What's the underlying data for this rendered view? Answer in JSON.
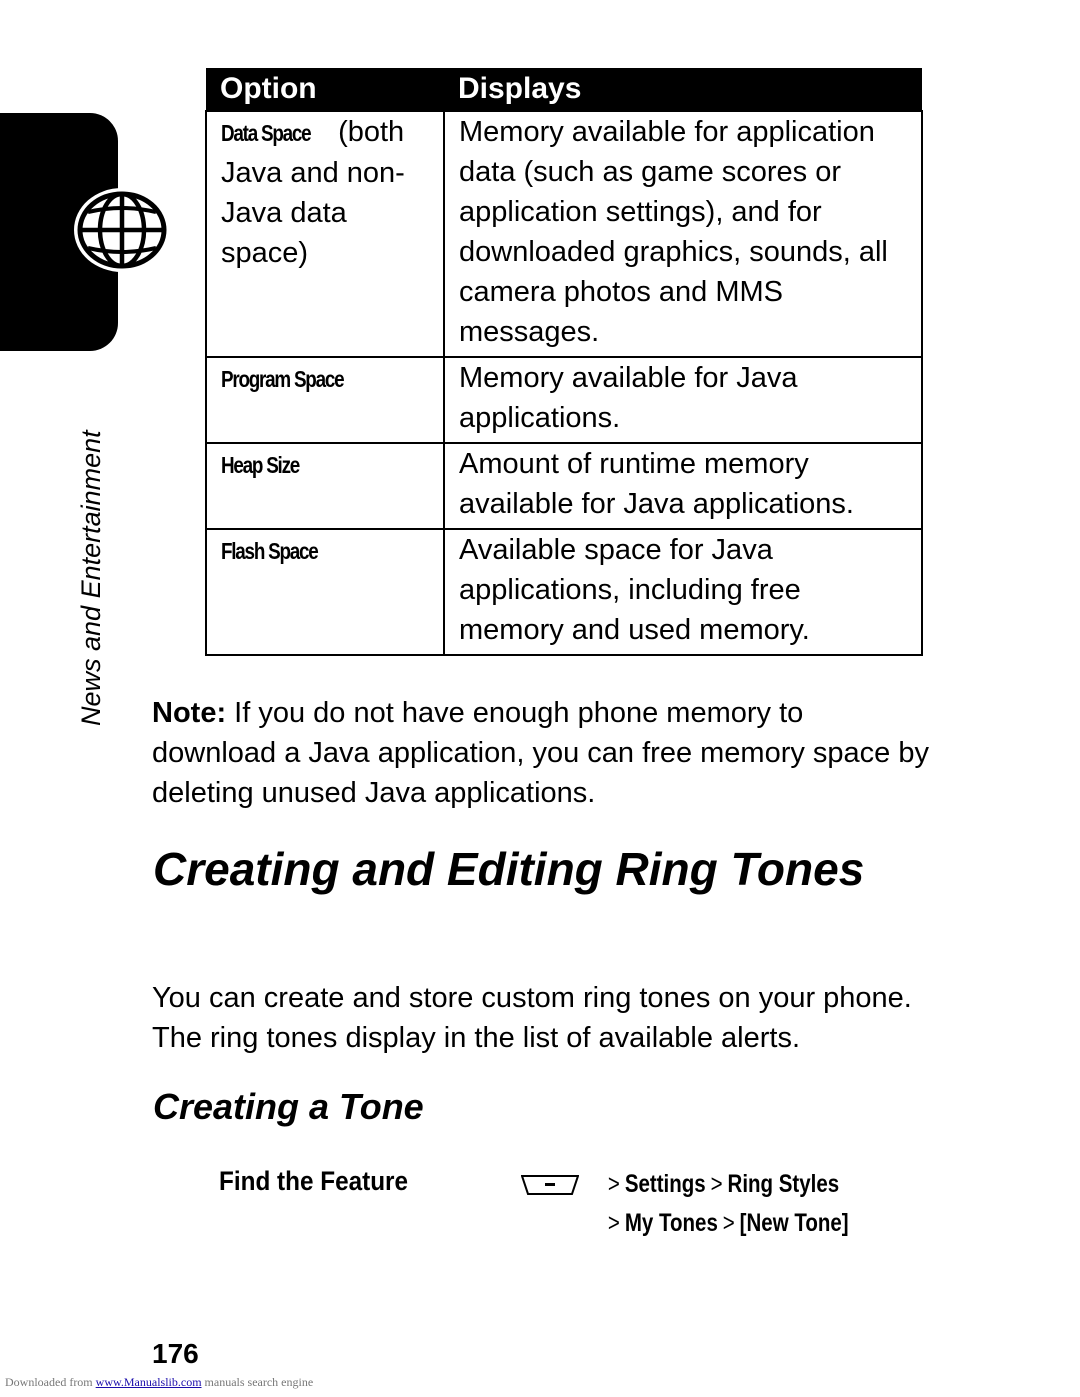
{
  "side_tab": {
    "icon": "globe-icon",
    "section_label": "News and Entertainment"
  },
  "table": {
    "headers": [
      "Option",
      "Displays"
    ],
    "rows": [
      {
        "option": "Data Space",
        "option_suffix": " (both Java and non-Java data space)",
        "displays": "Memory available for application data (such as game scores or application settings), and for downloaded graphics, sounds, all camera photos and MMS messages."
      },
      {
        "option": "Program Space",
        "option_suffix": "",
        "displays": "Memory available for Java applications."
      },
      {
        "option": "Heap Size",
        "option_suffix": "",
        "displays": "Amount of runtime memory available for Java applications."
      },
      {
        "option": "Flash Space",
        "option_suffix": "",
        "displays": "Available space for Java applications, including free memory and used memory."
      }
    ]
  },
  "note": {
    "label": "Note:",
    "text": " If you do not have enough phone memory to download a Java application, you can free memory space by deleting unused Java applications."
  },
  "section_title": "Creating and Editing Ring Tones",
  "intro": "You can create and store custom ring tones on your phone. The ring tones display in the list of available alerts.",
  "subsection_title": "Creating a Tone",
  "find_feature": {
    "label": "Find the Feature",
    "key_icon": "menu-key-icon",
    "separator": ">",
    "path_line1": [
      "Settings",
      "Ring Styles"
    ],
    "path_line2": [
      "My Tones",
      "[New Tone]"
    ]
  },
  "page_number": "176",
  "footer": {
    "prefix": "Downloaded from ",
    "link": "www.Manualslib.com",
    "suffix": " manuals search engine"
  }
}
